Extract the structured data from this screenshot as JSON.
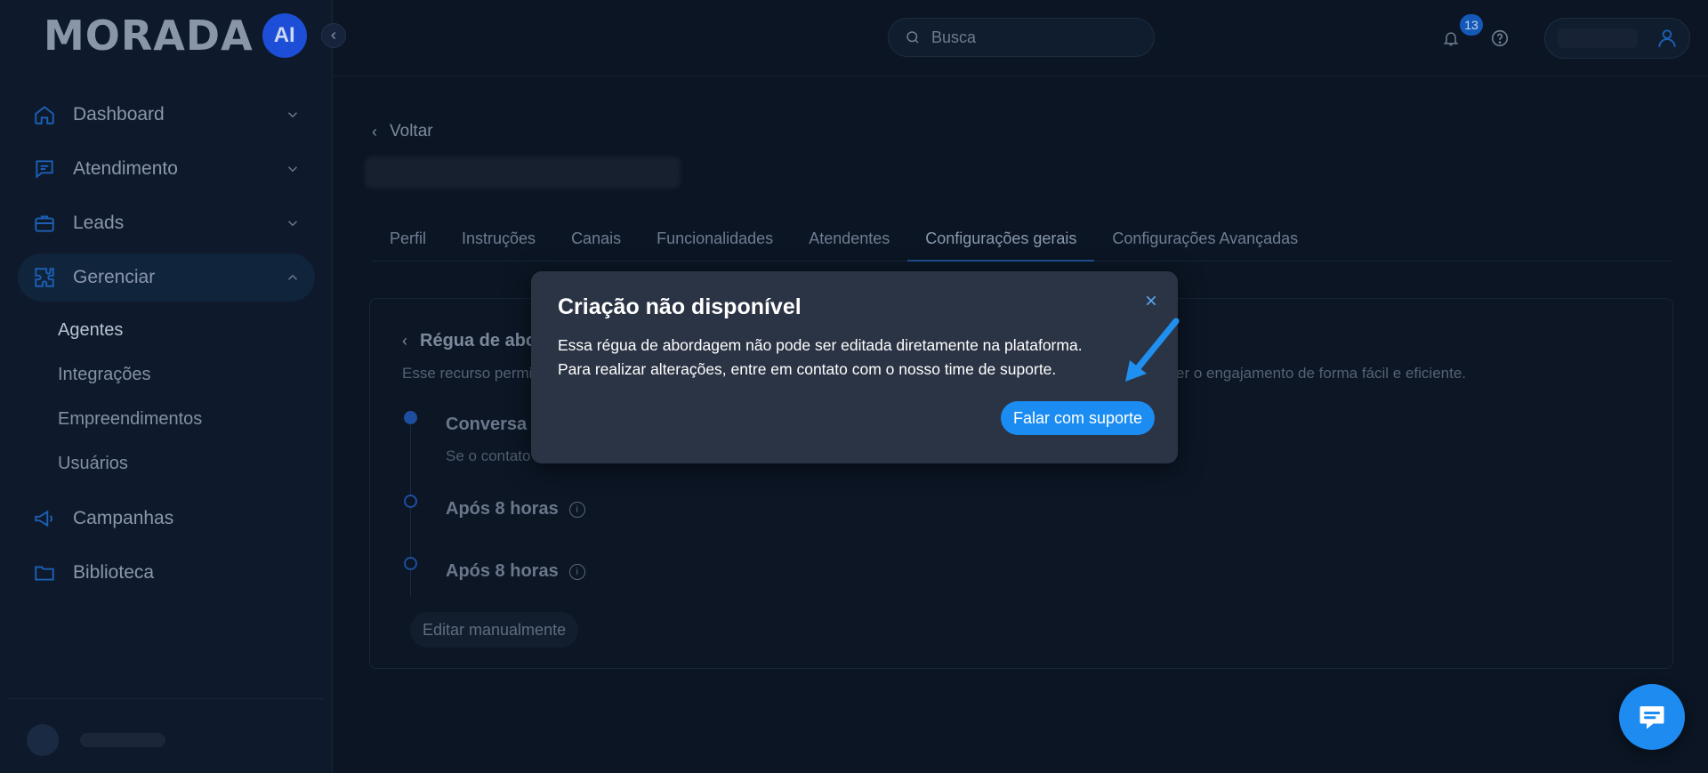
{
  "brand": {
    "logo_text": "MORADA",
    "logo_badge": "AI"
  },
  "sidebar": {
    "items": [
      {
        "label": "Dashboard",
        "icon": "home-icon"
      },
      {
        "label": "Atendimento",
        "icon": "chat-icon"
      },
      {
        "label": "Leads",
        "icon": "briefcase-icon"
      },
      {
        "label": "Gerenciar",
        "icon": "puzzle-icon"
      }
    ],
    "subitems": [
      "Agentes",
      "Integrações",
      "Empreendimentos",
      "Usuários"
    ],
    "bottom_items": [
      {
        "label": "Campanhas",
        "icon": "megaphone-icon"
      },
      {
        "label": "Biblioteca",
        "icon": "folder-icon"
      }
    ]
  },
  "header": {
    "search_placeholder": "Busca",
    "notification_count": "13"
  },
  "page": {
    "back_label": "Voltar",
    "tabs": [
      "Perfil",
      "Instruções",
      "Canais",
      "Funcionalidades",
      "Atendentes",
      "Configurações gerais",
      "Configurações Avançadas"
    ],
    "active_tab": "Configurações gerais",
    "card": {
      "title_visible": "Régua de abo",
      "description_left": "Esse recurso permi",
      "description_right": "er o engajamento de forma fácil e eficiente.",
      "step1_label": "Conversa i",
      "step1_sub": "Se o contato",
      "step2_label": "Após 8 horas",
      "step3_label": "Após 8 horas",
      "edit_button": "Editar manualmente"
    }
  },
  "modal": {
    "title": "Criação não disponível",
    "body": "Essa régua de abordagem não pode ser editada diretamente na plataforma. Para realizar alterações, entre em contato com o nosso time de suporte.",
    "button": "Falar com suporte"
  },
  "colors": {
    "accent": "#1b8cf2",
    "modal_bg": "#2b3445",
    "background": "#0b1523",
    "arrow": "#1f8ff0"
  }
}
